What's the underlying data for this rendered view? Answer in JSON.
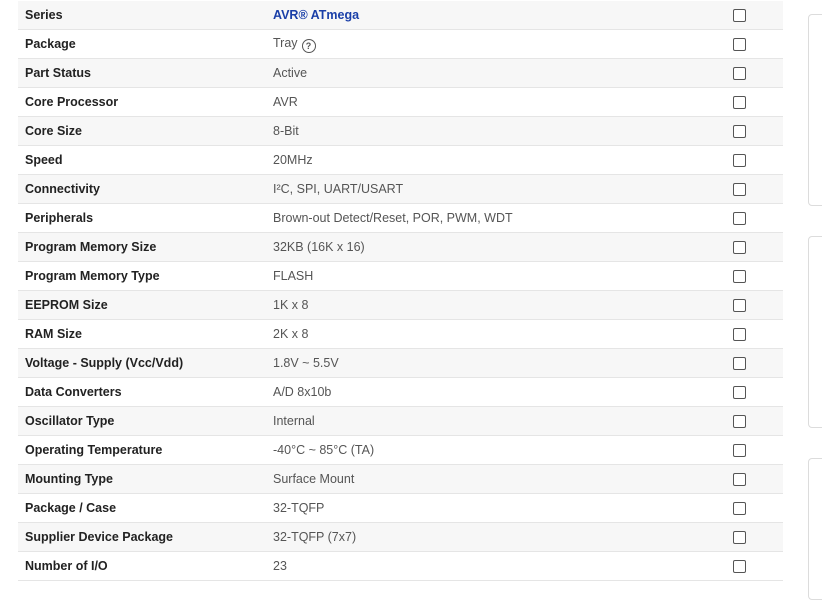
{
  "specs": [
    {
      "label": "Series",
      "value": "AVR® ATmega",
      "link": true
    },
    {
      "label": "Package",
      "value": "Tray",
      "help": true
    },
    {
      "label": "Part Status",
      "value": "Active"
    },
    {
      "label": "Core Processor",
      "value": "AVR"
    },
    {
      "label": "Core Size",
      "value": "8-Bit"
    },
    {
      "label": "Speed",
      "value": "20MHz"
    },
    {
      "label": "Connectivity",
      "value": "I²C, SPI, UART/USART"
    },
    {
      "label": "Peripherals",
      "value": "Brown-out Detect/Reset, POR, PWM, WDT"
    },
    {
      "label": "Program Memory Size",
      "value": "32KB (16K x 16)"
    },
    {
      "label": "Program Memory Type",
      "value": "FLASH"
    },
    {
      "label": "EEPROM Size",
      "value": "1K x 8"
    },
    {
      "label": "RAM Size",
      "value": "2K x 8"
    },
    {
      "label": "Voltage - Supply (Vcc/Vdd)",
      "value": "1.8V ~ 5.5V"
    },
    {
      "label": "Data Converters",
      "value": "A/D 8x10b"
    },
    {
      "label": "Oscillator Type",
      "value": "Internal"
    },
    {
      "label": "Operating Temperature",
      "value": "-40°C ~ 85°C (TA)"
    },
    {
      "label": "Mounting Type",
      "value": "Surface Mount"
    },
    {
      "label": "Package / Case",
      "value": "32-TQFP"
    },
    {
      "label": "Supplier Device Package",
      "value": "32-TQFP (7x7)"
    },
    {
      "label": "Number of I/O",
      "value": "23"
    }
  ],
  "help_icon_glyph": "?",
  "colors": {
    "link": "#1a3fa8",
    "row_alt": "#f7f7f7",
    "border": "#e5e5e5"
  }
}
